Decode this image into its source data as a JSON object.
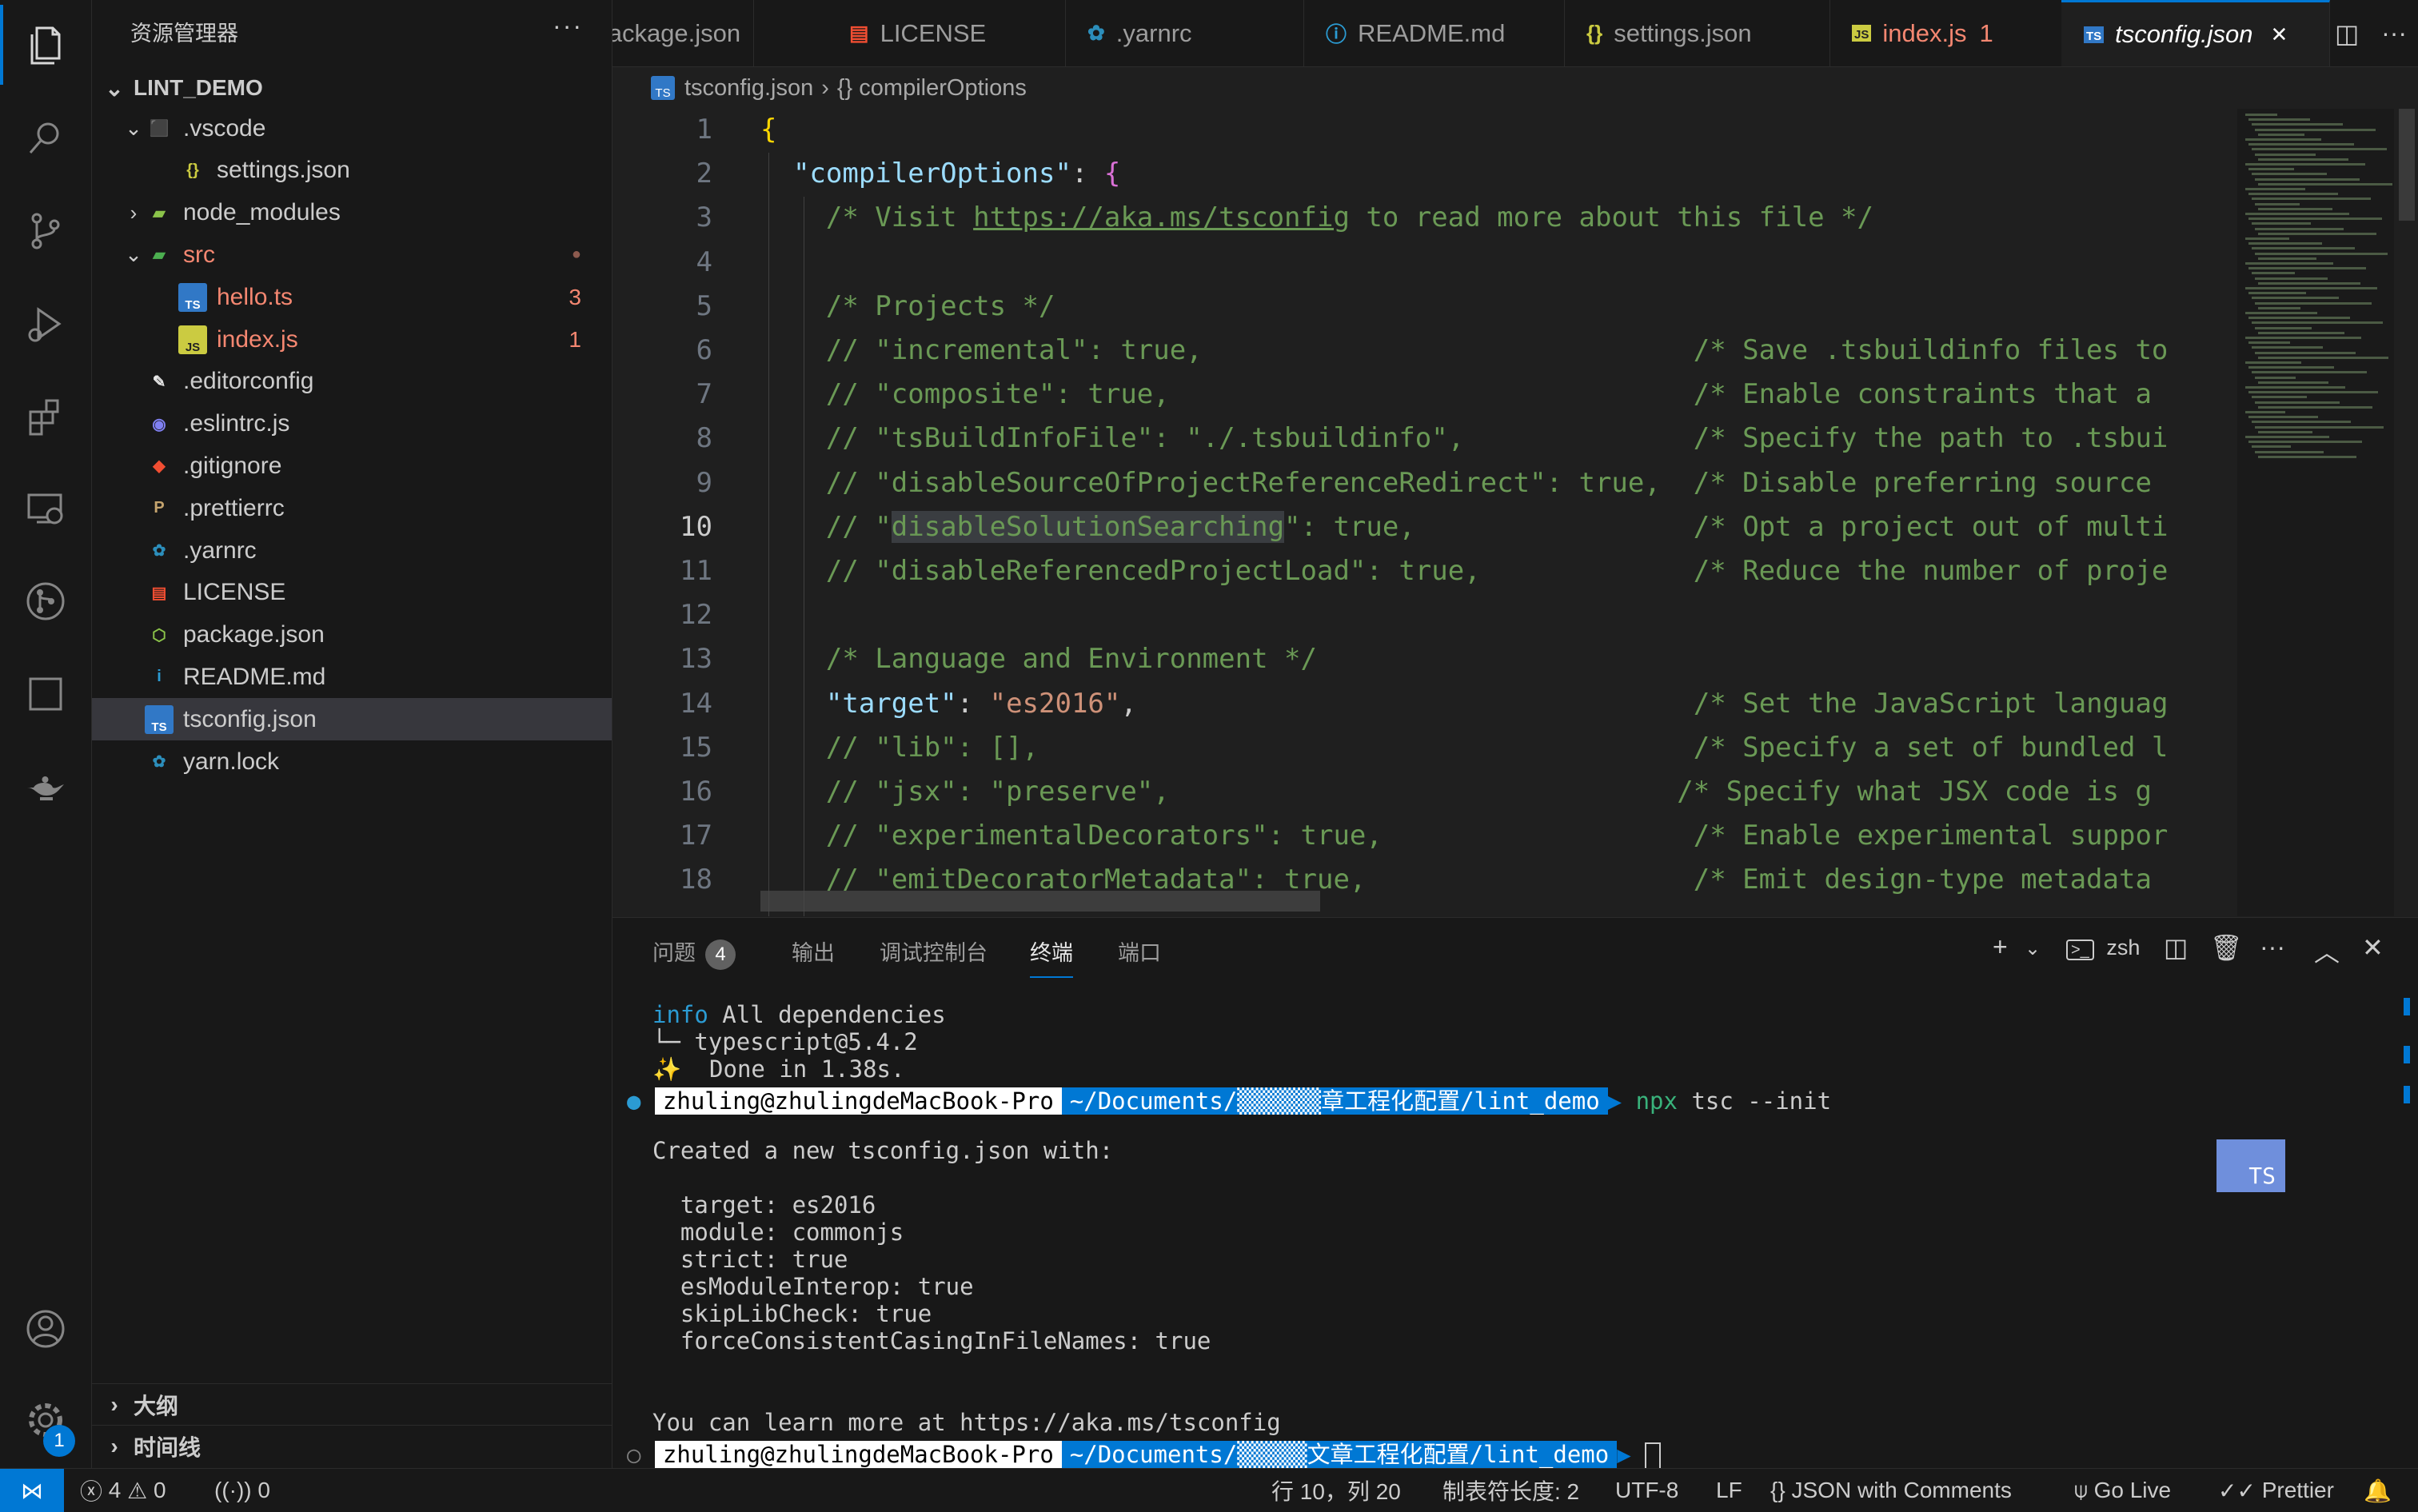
{
  "activity": {
    "items": [
      "explorer-icon",
      "search-icon",
      "source-control-icon",
      "run-debug-icon",
      "extensions-icon",
      "remote-explorer-icon",
      "git-graph-icon",
      "square-icon",
      "genie-lamp-icon"
    ],
    "bottom": [
      "account-icon",
      "settings-gear-icon"
    ],
    "settings_badge": "1"
  },
  "sidebar": {
    "title": "资源管理器",
    "more": "···",
    "project": "LINT_DEMO",
    "tree": [
      {
        "label": ".vscode",
        "depth": 1,
        "chevron": "⌄",
        "icon": "vscode-folder-icon",
        "color": "#cccccc"
      },
      {
        "label": "settings.json",
        "depth": 2,
        "chevron": "",
        "icon": "json-file-icon",
        "color": "#cccccc"
      },
      {
        "label": "node_modules",
        "depth": 1,
        "chevron": "›",
        "icon": "node-folder-icon",
        "color": "#cccccc"
      },
      {
        "label": "src",
        "depth": 1,
        "chevron": "⌄",
        "icon": "src-folder-icon",
        "color": "#f48771",
        "badge": "●"
      },
      {
        "label": "hello.ts",
        "depth": 2,
        "chevron": "",
        "icon": "typescript-file-icon",
        "color": "#f48771",
        "badge": "3"
      },
      {
        "label": "index.js",
        "depth": 2,
        "chevron": "",
        "icon": "javascript-file-icon",
        "color": "#f48771",
        "badge": "1"
      },
      {
        "label": ".editorconfig",
        "depth": 1,
        "chevron": "",
        "icon": "editorconfig-icon",
        "color": "#cccccc"
      },
      {
        "label": ".eslintrc.js",
        "depth": 1,
        "chevron": "",
        "icon": "eslint-icon",
        "color": "#cccccc"
      },
      {
        "label": ".gitignore",
        "depth": 1,
        "chevron": "",
        "icon": "git-icon",
        "color": "#cccccc"
      },
      {
        "label": ".prettierrc",
        "depth": 1,
        "chevron": "",
        "icon": "prettier-icon",
        "color": "#cccccc"
      },
      {
        "label": ".yarnrc",
        "depth": 1,
        "chevron": "",
        "icon": "yarn-icon",
        "color": "#cccccc"
      },
      {
        "label": "LICENSE",
        "depth": 1,
        "chevron": "",
        "icon": "license-icon",
        "color": "#cccccc"
      },
      {
        "label": "package.json",
        "depth": 1,
        "chevron": "",
        "icon": "nodejs-icon",
        "color": "#cccccc"
      },
      {
        "label": "README.md",
        "depth": 1,
        "chevron": "",
        "icon": "info-icon",
        "color": "#cccccc"
      },
      {
        "label": "tsconfig.json",
        "depth": 1,
        "chevron": "",
        "icon": "tsconfig-icon",
        "color": "#cccccc",
        "selected": true
      },
      {
        "label": "yarn.lock",
        "depth": 1,
        "chevron": "",
        "icon": "yarn-icon",
        "color": "#cccccc"
      }
    ],
    "outline": "大纲",
    "timeline": "时间线"
  },
  "tabs": [
    {
      "label": "ackage.json",
      "icon": "nodejs-icon",
      "color": "#9d9d9d"
    },
    {
      "label": "LICENSE",
      "icon": "license-icon",
      "color": "#9d9d9d"
    },
    {
      "label": ".yarnrc",
      "icon": "yarn-icon",
      "color": "#9d9d9d"
    },
    {
      "label": "README.md",
      "icon": "info-icon",
      "color": "#9d9d9d"
    },
    {
      "label": "settings.json",
      "icon": "json-file-icon",
      "color": "#9d9d9d"
    },
    {
      "label": "index.js",
      "icon": "javascript-file-icon",
      "color": "#f48771",
      "badge": "1"
    },
    {
      "label": "tsconfig.json",
      "icon": "tsconfig-icon",
      "color": "#ffffff",
      "active": true,
      "close": "✕"
    }
  ],
  "breadcrumb": {
    "file": "tsconfig.json",
    "sep": "›",
    "symbol": "{} compilerOptions"
  },
  "editor": {
    "current_line": 10,
    "lines": [
      {
        "n": "1",
        "segs": [
          {
            "t": "{",
            "c": "brace"
          }
        ]
      },
      {
        "n": "2",
        "segs": [
          {
            "t": "  ",
            "c": ""
          },
          {
            "t": "\"compilerOptions\"",
            "c": "key"
          },
          {
            "t": ": ",
            "c": ""
          },
          {
            "t": "{",
            "c": "brace2"
          }
        ]
      },
      {
        "n": "3",
        "segs": [
          {
            "t": "    /* Visit ",
            "c": "cmt"
          },
          {
            "t": "https://aka.ms/tsconfig",
            "c": "lnk"
          },
          {
            "t": " to read more about this file */",
            "c": "cmt"
          }
        ]
      },
      {
        "n": "4",
        "segs": []
      },
      {
        "n": "5",
        "segs": [
          {
            "t": "    /* Projects */",
            "c": "cmt"
          }
        ]
      },
      {
        "n": "6",
        "segs": [
          {
            "t": "    // \"incremental\": true,                              /* Save .tsbuildinfo files to",
            "c": "cmt"
          }
        ]
      },
      {
        "n": "7",
        "segs": [
          {
            "t": "    // \"composite\": true,                                /* Enable constraints that a",
            "c": "cmt"
          }
        ]
      },
      {
        "n": "8",
        "segs": [
          {
            "t": "    // \"tsBuildInfoFile\": \"./.tsbuildinfo\",              /* Specify the path to .tsbui",
            "c": "cmt"
          }
        ]
      },
      {
        "n": "9",
        "segs": [
          {
            "t": "    // \"disableSourceOfProjectReferenceRedirect\": true,  /* Disable preferring source ",
            "c": "cmt"
          }
        ]
      },
      {
        "n": "10",
        "segs": [
          {
            "t": "    // \"",
            "c": "cmt"
          },
          {
            "t": "disableSolutionSearching",
            "c": "cmt hl"
          },
          {
            "t": "\": true,                 /* Opt a project out of multi",
            "c": "cmt"
          }
        ]
      },
      {
        "n": "11",
        "segs": [
          {
            "t": "    // \"disableReferencedProjectLoad\": true,             /* Reduce the number of proje",
            "c": "cmt"
          }
        ]
      },
      {
        "n": "12",
        "segs": []
      },
      {
        "n": "13",
        "segs": [
          {
            "t": "    /* Language and Environment */",
            "c": "cmt"
          }
        ]
      },
      {
        "n": "14",
        "segs": [
          {
            "t": "    ",
            "c": ""
          },
          {
            "t": "\"target\"",
            "c": "key"
          },
          {
            "t": ": ",
            "c": ""
          },
          {
            "t": "\"es2016\"",
            "c": "str"
          },
          {
            "t": ",",
            "c": ""
          },
          {
            "t": "                                  /* Set the JavaScript languag",
            "c": "cmt"
          }
        ]
      },
      {
        "n": "15",
        "segs": [
          {
            "t": "    // \"lib\": [],                                        /* Specify a set of bundled l",
            "c": "cmt"
          }
        ]
      },
      {
        "n": "16",
        "segs": [
          {
            "t": "    // \"jsx\": \"preserve\",                               /* Specify what JSX code is g",
            "c": "cmt"
          }
        ]
      },
      {
        "n": "17",
        "segs": [
          {
            "t": "    // \"experimentalDecorators\": true,                   /* Enable experimental suppor",
            "c": "cmt"
          }
        ]
      },
      {
        "n": "18",
        "segs": [
          {
            "t": "    // \"emitDecoratorMetadata\": true,                    /* Emit design-type metadata ",
            "c": "cmt"
          }
        ]
      }
    ]
  },
  "panel": {
    "tabs": [
      {
        "label": "问题",
        "badge": "4"
      },
      {
        "label": "输出"
      },
      {
        "label": "调试控制台"
      },
      {
        "label": "终端",
        "active": true
      },
      {
        "label": "端口"
      }
    ],
    "actions": {
      "add": "+",
      "add_chevron": "⌄",
      "shell": "zsh"
    },
    "terminal": {
      "l1_info": "info",
      "l1_rest": " All dependencies",
      "l2": "└─ typescript@5.4.2",
      "l3": "✨  Done in 1.38s.",
      "prompt_user": "zhuling@zhulingdeMacBook-Pro",
      "prompt_path1": "~/Documents/▒▒▒▒▒▒章工程化配置/lint_demo",
      "prompt_path2": "~/Documents/▒▒▒▒▒文章工程化配置/lint_demo",
      "cmd_npx": "npx",
      "cmd_rest": " tsc --init",
      "created": "Created a new tsconfig.json with:",
      "options": [
        "  target: es2016",
        "  module: commonjs",
        "  strict: true",
        "  esModuleInterop: true",
        "  skipLibCheck: true",
        "  forceConsistentCasingInFileNames: true"
      ],
      "learn": "You can learn more at https://aka.ms/tsconfig",
      "ts_overlay": "TS"
    }
  },
  "statusbar": {
    "remote": "⋈",
    "errors": "4",
    "warnings": "0",
    "ports": "0",
    "position": "行 10，列 20",
    "tab_size": "制表符长度: 2",
    "encoding": "UTF-8",
    "eol": "LF",
    "language": "JSON with Comments",
    "go_live": "Go Live",
    "prettier": "Prettier"
  }
}
